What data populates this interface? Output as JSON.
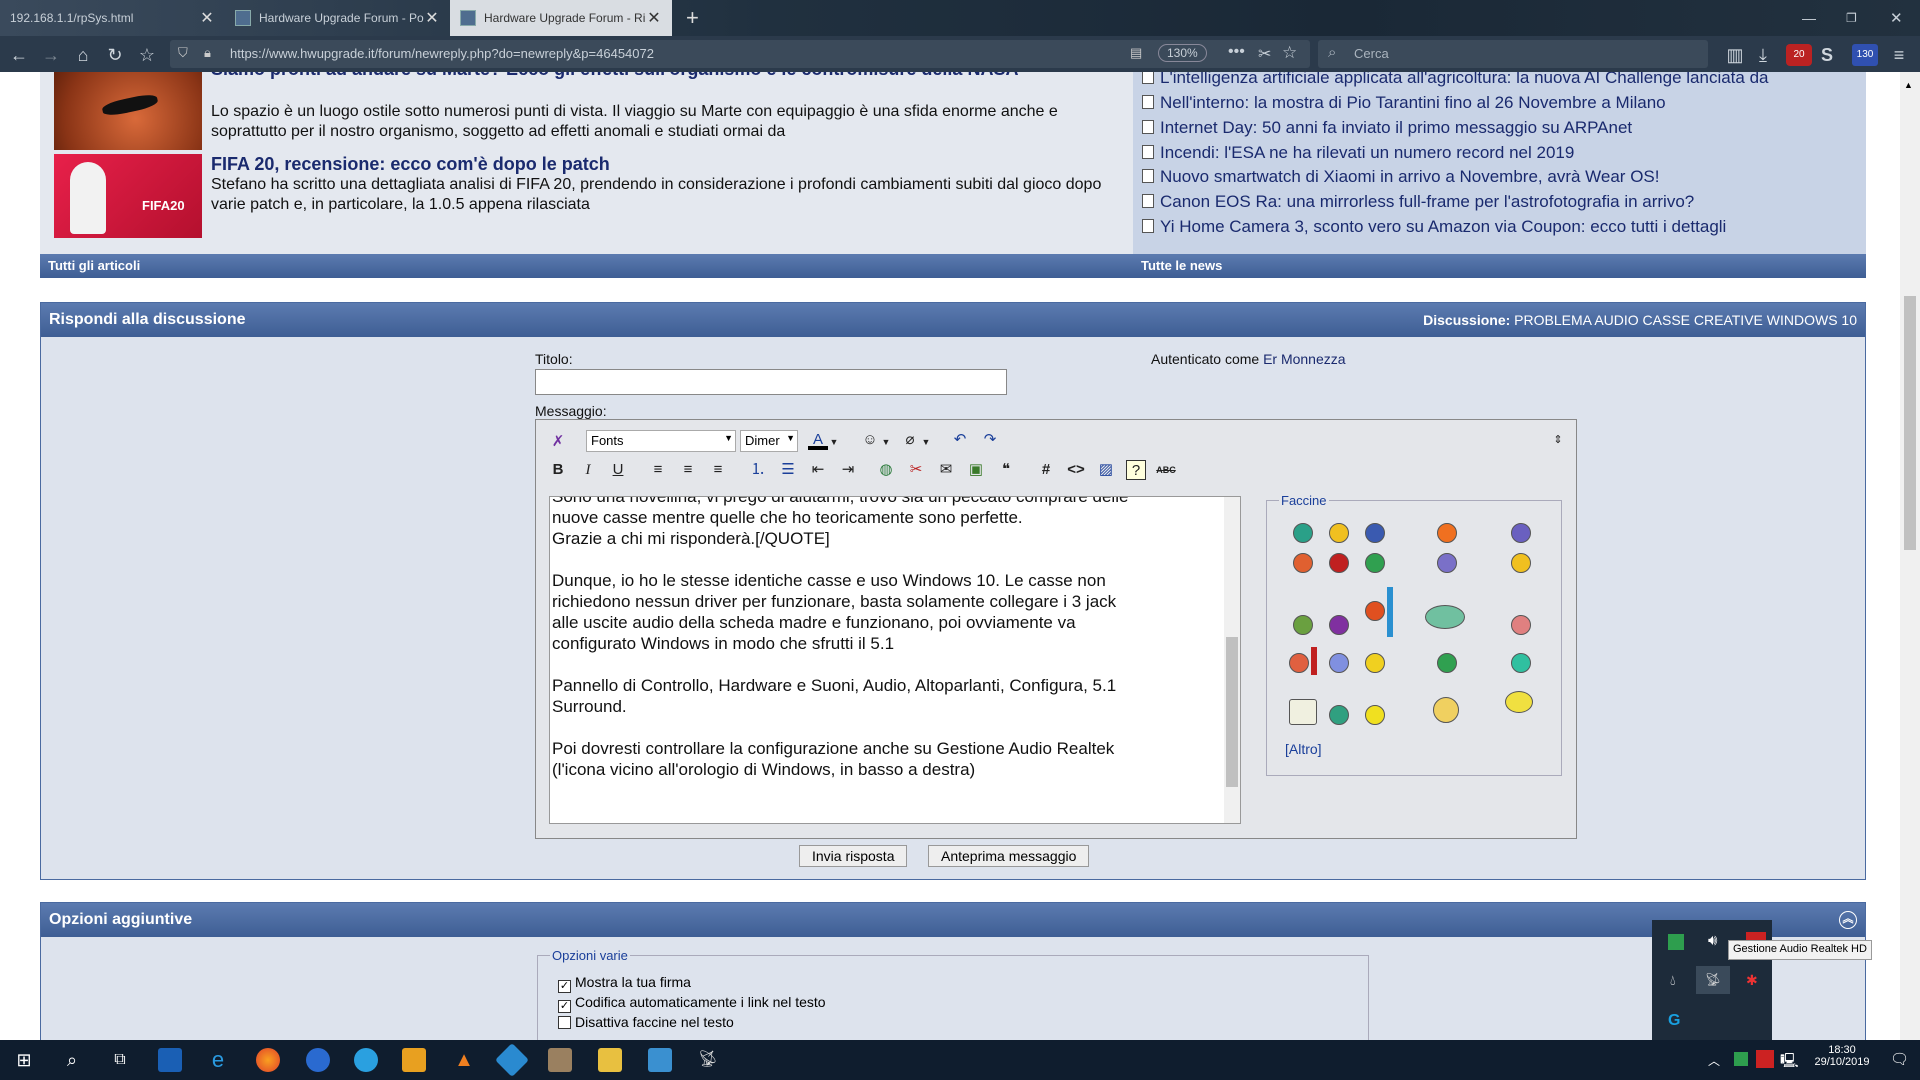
{
  "browser": {
    "tabs": [
      {
        "label": "192.168.1.1/rpSys.html",
        "active": false
      },
      {
        "label": "Hardware Upgrade Forum - Po",
        "active": false
      },
      {
        "label": "Hardware Upgrade Forum - Ri",
        "active": true
      }
    ],
    "url": "https://www.hwupgrade.it/forum/newreply.php?do=newreply&p=46454072",
    "zoom": "130%",
    "search_placeholder": "Cerca",
    "badges": {
      "ublock": "20",
      "ext": "130"
    }
  },
  "news": {
    "articles": [
      {
        "title": "Siamo pronti ad andare su Marte? Ecco gli effetti sull'organismo e le contromisure della NASA",
        "desc": "Lo spazio è un luogo ostile sotto numerosi punti di vista. Il viaggio su Marte con equipaggio è una sfida enorme anche e soprattutto per il nostro organismo, soggetto ad effetti anomali e studiati ormai da"
      },
      {
        "title": "FIFA 20, recensione: ecco com'è dopo le patch",
        "desc": "Stefano ha scritto una dettagliata analisi di FIFA 20, prendendo in considerazione i profondi cambiamenti subiti dal gioco dopo varie patch e, in particolare, la 1.0.5 appena rilasciata"
      }
    ],
    "fifa_logo": "FIFA20",
    "headlines": [
      "L'intelligenza artificiale applicata all'agricoltura: la nuova AI Challenge lanciata da",
      "Nell'interno: la mostra di Pio Tarantini fino al 26 Novembre a Milano",
      "Internet Day: 50 anni fa inviato il primo messaggio su ARPAnet",
      "Incendi: l'ESA ne ha rilevati un numero record nel 2019",
      "Nuovo smartwatch di Xiaomi in arrivo a Novembre, avrà Wear OS!",
      "Canon EOS Ra: una mirrorless full-frame per l'astrofotografia in arrivo?",
      "Yi Home Camera 3, sconto vero su Amazon via Coupon: ecco tutti i dettagli"
    ],
    "all_articles": "Tutti gli articoli",
    "all_news": "Tutte le news"
  },
  "reply": {
    "header": "Rispondi alla discussione",
    "thread_label": "Discussione:",
    "thread_title": "PROBLEMA AUDIO CASSE CREATIVE WINDOWS 10",
    "title_label": "Titolo:",
    "title_value": "",
    "auth_label": "Autenticato come",
    "auth_user": "Er Monnezza",
    "message_label": "Messaggio:",
    "font_select": "Fonts",
    "size_select": "Dimer",
    "message_lines": [
      "Sono una novellina, vi prego di aiutarmi, trovo sia un peccato comprare delle",
      "nuove casse mentre quelle che ho teoricamente sono perfette.",
      "Grazie a chi mi risponderà.[/QUOTE]",
      "",
      "Dunque, io ho le stesse identiche casse e uso Windows 10. Le casse non",
      "richiedono nessun driver per funzionare, basta solamente collegare i 3 jack",
      "alle uscite audio della scheda madre e funzionano, poi ovviamente va",
      "configurato Windows in modo che sfrutti il 5.1",
      "",
      "Pannello di Controllo, Hardware e Suoni, Audio, Altoparlanti, Configura, 5.1",
      "Surround.",
      "",
      "Poi dovresti controllare la configurazione anche su Gestione Audio Realtek",
      "(l'icona vicino all'orologio di Windows, in basso a destra)"
    ],
    "smilies_title": "Faccine",
    "smilies_more": "[Altro]",
    "submit": "Invia risposta",
    "preview": "Anteprima messaggio"
  },
  "options": {
    "header": "Opzioni aggiuntive",
    "group": "Opzioni varie",
    "items": [
      {
        "label": "Mostra la tua firma",
        "checked": true
      },
      {
        "label": "Codifica automaticamente i link nel testo",
        "checked": true
      },
      {
        "label": "Disattiva faccine nel testo",
        "checked": false
      }
    ]
  },
  "tray": {
    "tooltip": "Gestione Audio Realtek HD",
    "time": "18:30",
    "date": "29/10/2019"
  },
  "colors": {
    "accent": "#3e5e94",
    "link": "#1a2a6e",
    "panel_bg": "#dde3ed"
  }
}
